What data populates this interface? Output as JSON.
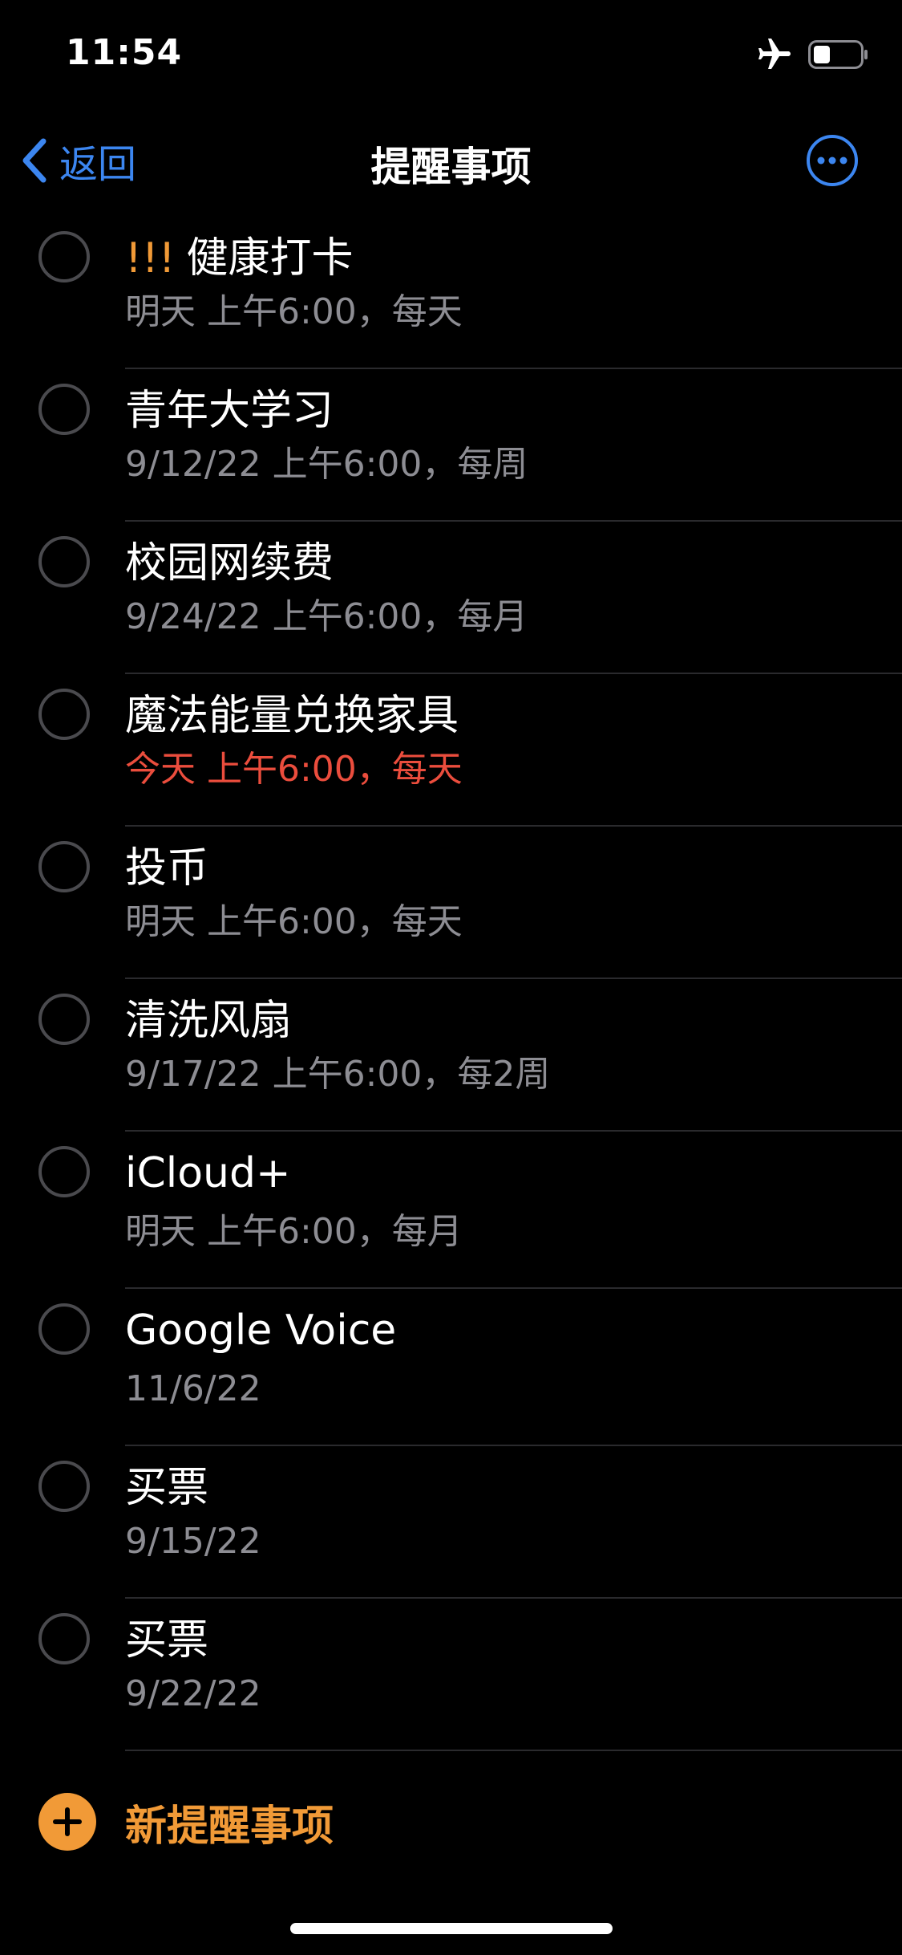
{
  "status_bar": {
    "time": "11:54",
    "icons": [
      "airplane-icon",
      "battery-icon"
    ]
  },
  "nav": {
    "back_label": "返回",
    "title": "提醒事项",
    "more_icon": "ellipsis-circle-icon"
  },
  "colors": {
    "accent_blue": "#3c86f0",
    "accent_orange": "#f19a37",
    "overdue_red": "#eb4d3d",
    "secondary_gray": "#8d8d93"
  },
  "reminders": [
    {
      "priority": "!!!",
      "title": "健康打卡",
      "subtitle": "明天 上午6:00，每天",
      "overdue": false
    },
    {
      "priority": "",
      "title": "青年大学习",
      "subtitle": "9/12/22 上午6:00，每周",
      "overdue": false
    },
    {
      "priority": "",
      "title": "校园网续费",
      "subtitle": "9/24/22 上午6:00，每月",
      "overdue": false
    },
    {
      "priority": "",
      "title": "魔法能量兑换家具",
      "subtitle": "今天 上午6:00，每天",
      "overdue": true
    },
    {
      "priority": "",
      "title": "投币",
      "subtitle": "明天 上午6:00，每天",
      "overdue": false
    },
    {
      "priority": "",
      "title": "清洗风扇",
      "subtitle": "9/17/22 上午6:00，每2周",
      "overdue": false
    },
    {
      "priority": "",
      "title": "iCloud+",
      "subtitle": "明天 上午6:00，每月",
      "overdue": false
    },
    {
      "priority": "",
      "title": "Google Voice",
      "subtitle": "11/6/22",
      "overdue": false
    },
    {
      "priority": "",
      "title": "买票",
      "subtitle": "9/15/22",
      "overdue": false
    },
    {
      "priority": "",
      "title": "买票",
      "subtitle": "9/22/22",
      "overdue": false
    }
  ],
  "new_reminder": {
    "label": "新提醒事项",
    "icon": "plus-circle-icon"
  }
}
